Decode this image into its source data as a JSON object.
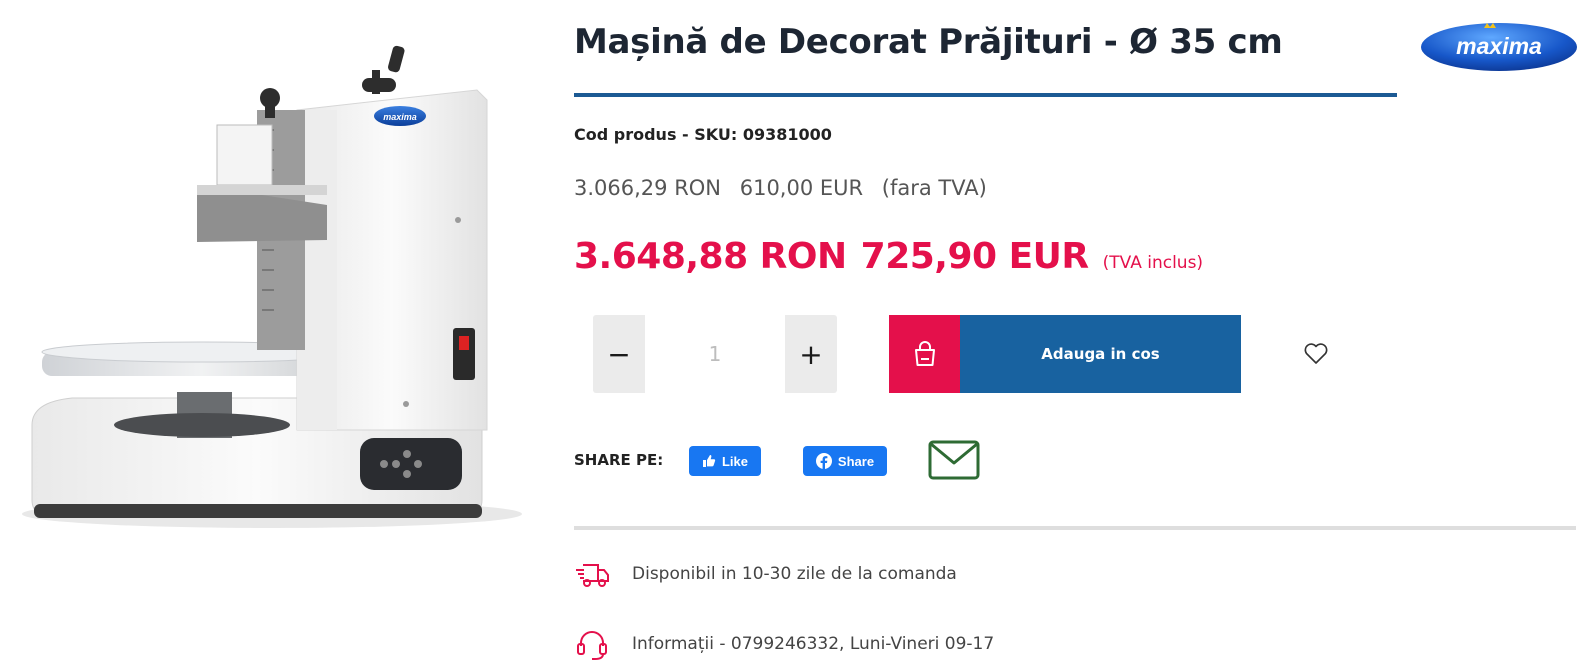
{
  "product": {
    "title": "Mașină de Decorat Prăjituri - Ø 35 cm",
    "sku_line": "Cod produs - SKU: 09381000",
    "image_logo_text": "maxima"
  },
  "brand": {
    "logo_text": "maxima"
  },
  "price": {
    "ex_vat_ron": "3.066,29 RON",
    "ex_vat_eur": "610,00 EUR",
    "ex_vat_note": "(fara TVA)",
    "inc_vat_ron": "3.648,88 RON",
    "inc_vat_eur": "725,90 EUR",
    "inc_vat_note": "(TVA inclus)"
  },
  "quantity": {
    "value": "1",
    "minus": "−",
    "plus": "+"
  },
  "cart": {
    "label": "Adauga in cos",
    "icon": "shopping-bag-icon"
  },
  "wishlist": {
    "icon": "heart-icon"
  },
  "share": {
    "label": "SHARE PE:",
    "like_label": "Like",
    "share_label": "Share",
    "email_icon": "mail-icon"
  },
  "info": {
    "delivery": "Disponibil in 10-30 zile de la comanda",
    "contact": "Informații - 0799246332, Luni-Vineri 09-17"
  },
  "colors": {
    "accent_red": "#e4104b",
    "accent_blue": "#1862a0",
    "rule_blue": "#1c5a94",
    "facebook": "#1877f2",
    "mail_green": "#2e6b34"
  }
}
